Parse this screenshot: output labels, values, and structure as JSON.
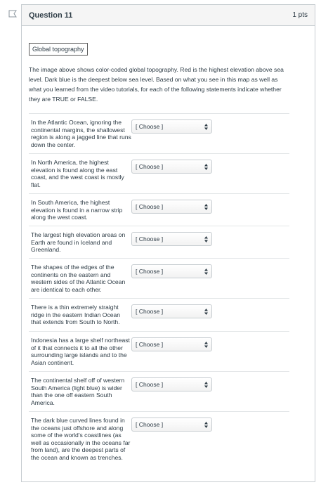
{
  "question": {
    "title": "Question 11",
    "points": "1 pts",
    "tag": "Global topography",
    "prompt": "The image above shows color-coded global topography. Red is the highest elevation above sea level. Dark blue is the deepest below sea level. Based on what you see in this map as well as what you learned from the video tutorials, for each of the following statements indicate whether they are TRUE or FALSE."
  },
  "statements": [
    {
      "text": "In the Atlantic Ocean, ignoring the continental margins, the shallowest region is along a jagged line that runs down the center.",
      "select": "[ Choose ]"
    },
    {
      "text": "In North America, the highest elevation is found along the east coast, and the west coast is mostly flat.",
      "select": "[ Choose ]"
    },
    {
      "text": "In South America, the highest elevation is found in a narrow strip along the west coast.",
      "select": "[ Choose ]"
    },
    {
      "text": "The largest high elevation areas on Earth are found in Iceland and Greenland.",
      "select": "[ Choose ]"
    },
    {
      "text": "The shapes of the edges of the continents on the eastern and western sides of the Atlantic Ocean are identical to each other.",
      "select": "[ Choose ]"
    },
    {
      "text": "There is a thin extremely straight ridge in the eastern Indian Ocean that extends from South to North.",
      "select": "[ Choose ]"
    },
    {
      "text": "Indonesia has a large shelf northeast of it that connects it to all the other surrounding large islands and to the Asian continent.",
      "select": "[ Choose ]"
    },
    {
      "text": "The continental shelf off of western South America (light blue) is wider than the one off eastern South America.",
      "select": "[ Choose ]"
    },
    {
      "text": "The dark blue curved lines found in the oceans just offshore and along some of the world's coastlines (as well as occasionally in the oceans far from land), are the deepest parts of the ocean and known as trenches.",
      "select": "[ Choose ]"
    }
  ]
}
